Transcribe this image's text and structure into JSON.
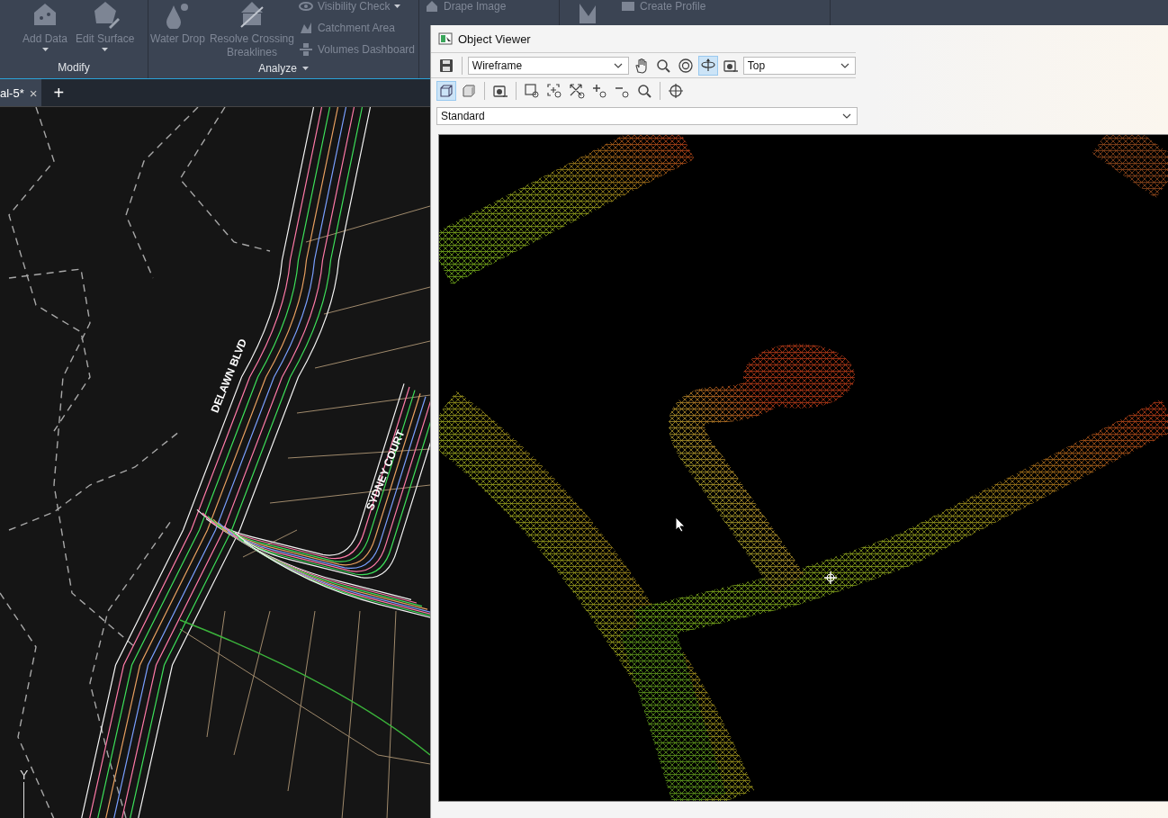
{
  "ribbon": {
    "panels": [
      {
        "label": "Modify",
        "has_menu": false,
        "large_tools": [
          {
            "kind": "add-data",
            "label": "Add Data",
            "has_menu": true
          },
          {
            "kind": "edit-surface",
            "label": "Edit Surface",
            "has_menu": true
          }
        ]
      },
      {
        "label": "Analyze",
        "has_menu": true,
        "large_tools": [
          {
            "kind": "water-drop",
            "label": "Water Drop",
            "has_menu": false
          },
          {
            "kind": "breaklines",
            "label": "Resolve Crossing Breaklines",
            "has_menu": false
          }
        ],
        "small_tools": [
          {
            "kind": "eye",
            "label": "Visibility Check",
            "has_menu": true
          },
          {
            "kind": "catchment",
            "label": "Catchment Area",
            "has_menu": false
          },
          {
            "kind": "volumes",
            "label": "Volumes Dashboard",
            "has_menu": false
          }
        ]
      },
      {
        "small_tools": [
          {
            "kind": "drape",
            "label": "Drape Image",
            "has_menu": false
          }
        ]
      },
      {
        "large_tools": [
          {
            "kind": "profile"
          }
        ],
        "small_tools": [
          {
            "kind": "profile",
            "label": "Create Profile",
            "has_menu": false
          }
        ]
      }
    ]
  },
  "file_tabs": [
    {
      "label": "al-5*",
      "selected": true,
      "close": "×"
    }
  ],
  "new_tab": "+",
  "drawing": {
    "labels": [
      {
        "kind": "street",
        "text": "DELAWN BLVD"
      },
      {
        "kind": "street",
        "text": "SYDNEY COURT"
      }
    ],
    "ucs_axis": "Y"
  },
  "object_viewer": {
    "title": "Object Viewer",
    "toolbar_1": [
      {
        "kind": "save",
        "selected": false
      },
      {
        "kind": "dropdown",
        "value": "Wireframe"
      },
      {
        "kind": "pan",
        "selected": false
      },
      {
        "kind": "zoom",
        "selected": false
      },
      {
        "kind": "orbit-free",
        "selected": false
      },
      {
        "kind": "orbit",
        "selected": true
      },
      {
        "kind": "camera",
        "selected": false
      },
      {
        "kind": "dropdown",
        "value": "Top"
      }
    ],
    "toolbar_2": [
      {
        "kind": "wire-cube",
        "selected": true
      },
      {
        "kind": "shaded-cube",
        "selected": false
      },
      {
        "kind": "camera",
        "selected": false
      },
      {
        "kind": "zoom-window",
        "selected": false
      },
      {
        "kind": "zoom-center",
        "selected": false
      },
      {
        "kind": "zoom-extents",
        "selected": false
      },
      {
        "kind": "zoom-in",
        "selected": false
      },
      {
        "kind": "zoom-out",
        "selected": false
      },
      {
        "kind": "zoom",
        "selected": false
      },
      {
        "kind": "target",
        "selected": false
      }
    ],
    "style_dropdown": "Standard"
  }
}
